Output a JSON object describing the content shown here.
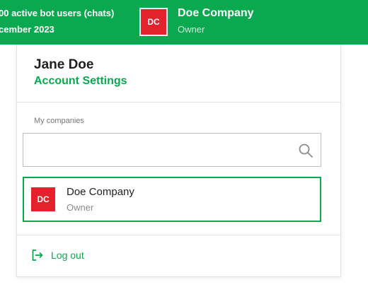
{
  "header": {
    "plan_line_1": "00 active bot users (chats)",
    "plan_line_2": "cember 2023",
    "avatar_initials": "DC",
    "company_name": "Doe Company",
    "company_role": "Owner"
  },
  "account_menu": {
    "user_name": "Jane Doe",
    "account_settings_label": "Account Settings",
    "companies_section_label": "My companies",
    "search": {
      "value": "",
      "placeholder": "",
      "icon": "search-icon"
    },
    "companies": [
      {
        "initials": "DC",
        "name": "Doe Company",
        "role": "Owner",
        "selected": true
      }
    ],
    "logout_label": "Log out",
    "logout_icon": "logout-icon"
  },
  "colors": {
    "brand_green": "#0aa84f",
    "avatar_red": "#e4222b"
  }
}
